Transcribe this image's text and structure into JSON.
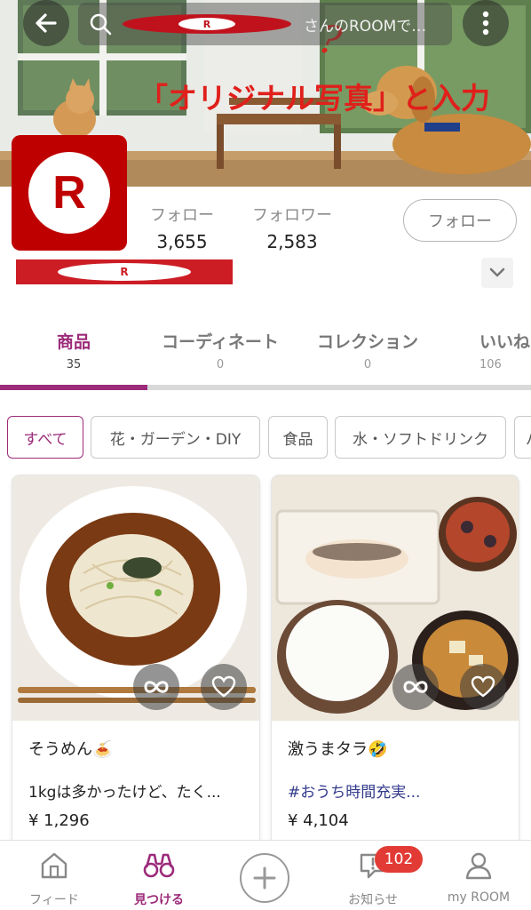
{
  "header": {
    "search_placeholder": "さんのROOMで…",
    "search_redacted_mark": "R",
    "annotation_mark": "?",
    "annotation_text": "「オリジナル写真」と入力"
  },
  "profile": {
    "avatar_letter": "R",
    "follow_label": "フォロー",
    "follow_count": "3,655",
    "follower_label": "フォロワー",
    "follower_count": "2,583",
    "follow_button": "フォロー",
    "name_redacted_mark": "R"
  },
  "tabs": [
    {
      "label": "商品",
      "count": "35",
      "active": true
    },
    {
      "label": "コーディネート",
      "count": "0"
    },
    {
      "label": "コレクション",
      "count": "0"
    },
    {
      "label": "いいね",
      "count": "106"
    }
  ],
  "chips": [
    {
      "label": "すべて",
      "active": true
    },
    {
      "label": "花・ガーデン・DIY"
    },
    {
      "label": "食品"
    },
    {
      "label": "水・ソフトドリンク"
    },
    {
      "label": "パ"
    }
  ],
  "products": [
    {
      "title": "そうめん🍝",
      "desc": "1kgは多かったけど、たく...",
      "price": "¥ 1,296"
    },
    {
      "title": "激うまタラ🤣",
      "desc": "#おうち時間充実...",
      "price": "¥ 4,104"
    }
  ],
  "bottom_nav": {
    "feed": "フィード",
    "find": "見つける",
    "notice": "お知らせ",
    "notice_badge": "102",
    "my": "my ROOM"
  },
  "colors": {
    "brand": "#bf0000",
    "accent": "#9c2b7a",
    "annotation": "#e0201b",
    "badge": "#e23b35"
  }
}
